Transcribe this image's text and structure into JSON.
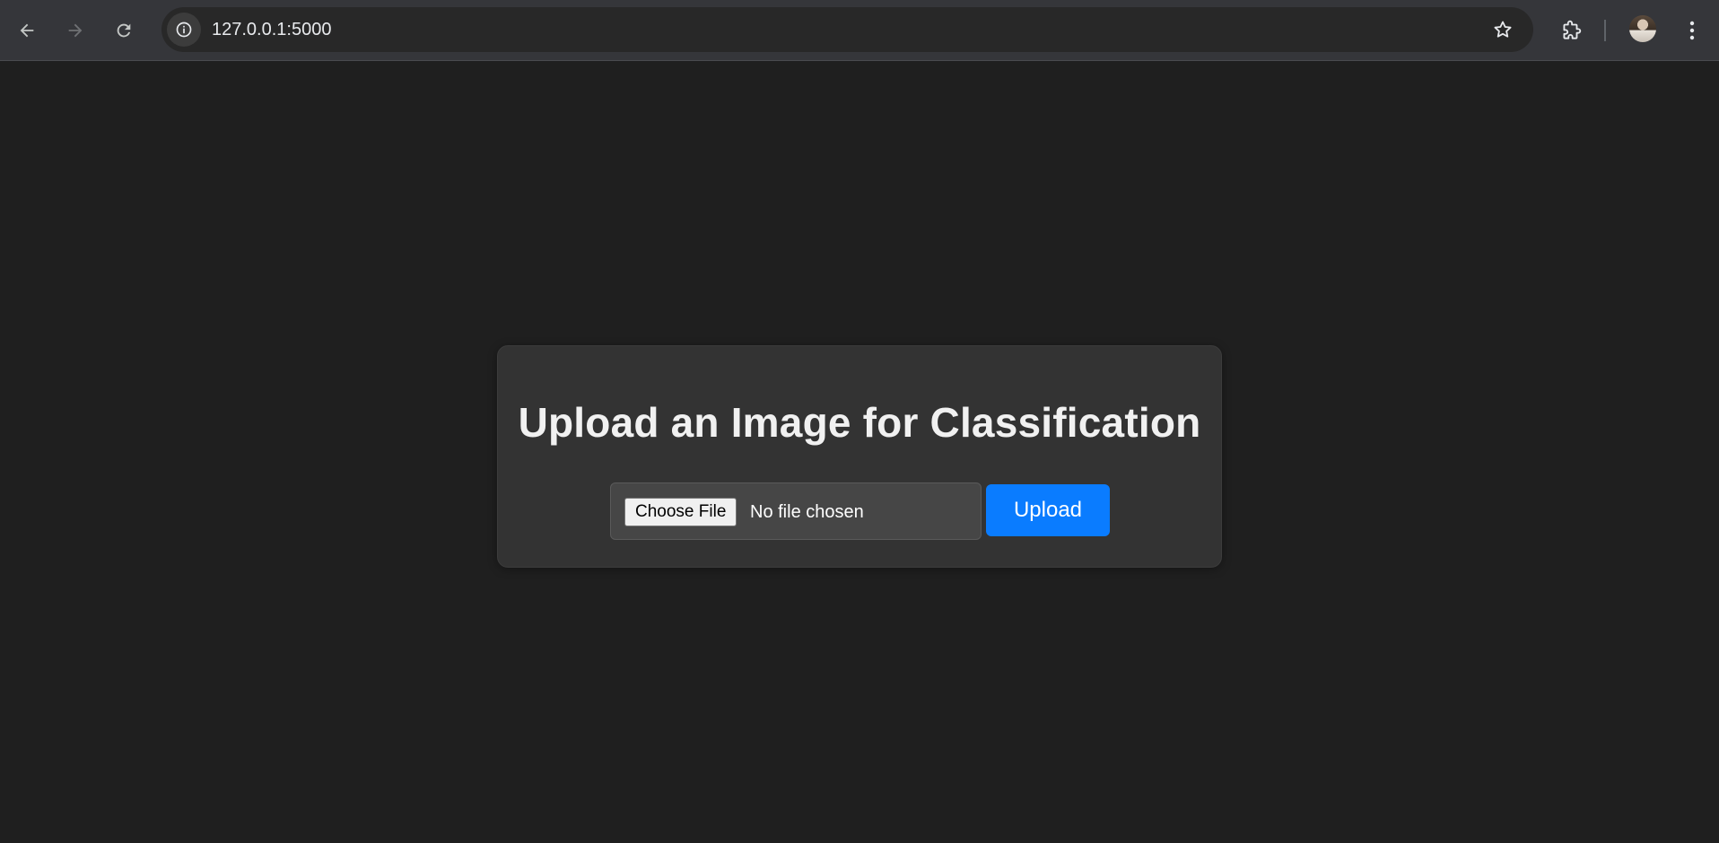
{
  "browser": {
    "url": "127.0.0.1:5000",
    "icons": {
      "back": "arrow-left-icon",
      "forward": "arrow-right-icon",
      "reload": "reload-icon",
      "site_info": "info-icon",
      "bookmark": "star-icon",
      "extensions": "puzzle-icon",
      "menu": "kebab-menu-icon"
    }
  },
  "page": {
    "title": "Upload an Image for Classification",
    "file_input": {
      "button_label": "Choose File",
      "status": "No file chosen"
    },
    "upload_button": "Upload"
  },
  "colors": {
    "page_background": "#1f1f1f",
    "card_background": "#333333",
    "accent": "#0a7cff",
    "toolbar": "#35363a"
  }
}
